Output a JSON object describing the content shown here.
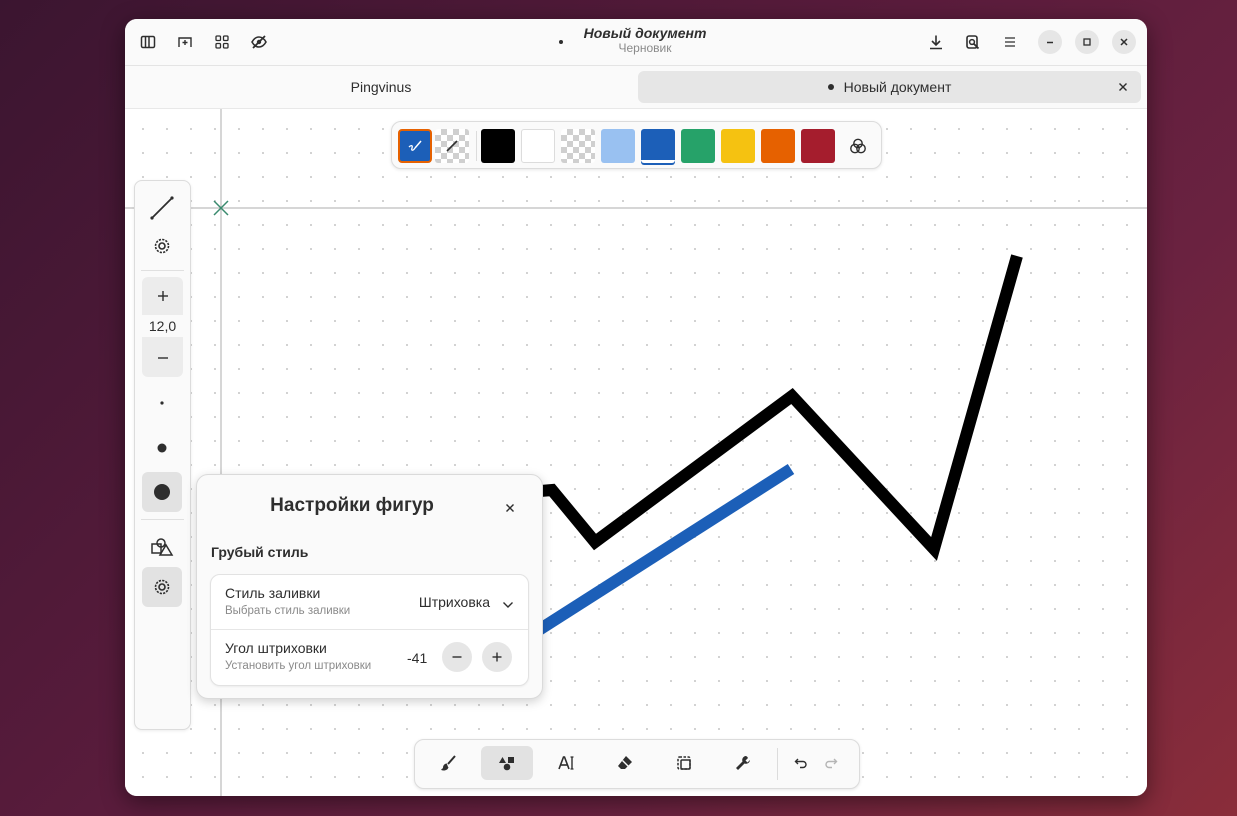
{
  "window": {
    "title": "Новый документ",
    "subtitle": "Черновик"
  },
  "headerbar": {
    "left_icons": [
      "sidebar-icon",
      "add-page-icon",
      "grid-icon",
      "hide-icon"
    ],
    "right_icons": [
      "download-icon",
      "export-icon",
      "menu-icon"
    ],
    "window_controls": [
      "minimize-icon",
      "maximize-icon",
      "close-icon"
    ]
  },
  "tabs": [
    {
      "label": "Pingvinus",
      "active": false
    },
    {
      "label": "Новый документ",
      "active": true,
      "modified": true
    }
  ],
  "palette": {
    "tools": [
      "color-picker-icon",
      "transparent-picker-icon"
    ],
    "colors": [
      "#000000",
      "#ffffff",
      "transparent",
      "#99c1f1",
      "#1c5fb8",
      "#26a269",
      "#f5c211",
      "#e66100",
      "#a51d2d"
    ],
    "selected_color": "#1c5fb8",
    "more_icon": "color-wheel-icon"
  },
  "left_toolbar": {
    "stroke_width": "12,0",
    "items": [
      "line-shape-icon",
      "settings-icon",
      "increase-icon",
      "decrease-icon",
      "small-dot-icon",
      "medium-dot-icon",
      "large-dot-icon",
      "shapes-icon",
      "shape-settings-icon"
    ]
  },
  "popover": {
    "title": "Настройки фигур",
    "group_title": "Грубый стиль",
    "fill_style": {
      "title": "Стиль заливки",
      "subtitle": "Выбрать стиль заливки",
      "value": "Штриховка"
    },
    "hatch_angle": {
      "title": "Угол штриховки",
      "subtitle": "Установить угол штриховки",
      "value": "-41"
    }
  },
  "bottom_toolbar": {
    "tools": [
      "brush-icon",
      "shapes-tool-icon",
      "text-tool-icon",
      "eraser-icon",
      "selection-icon",
      "tools-icon"
    ],
    "active_tool": "shapes-tool-icon",
    "history": [
      "undo-icon",
      "redo-icon"
    ]
  },
  "drawing": {
    "black_stroke_color": "#000000",
    "blue_stroke_color": "#1c5fb8",
    "grid_line_color": "#c8c8c8",
    "origin_marker_color": "#3a8a6e"
  }
}
